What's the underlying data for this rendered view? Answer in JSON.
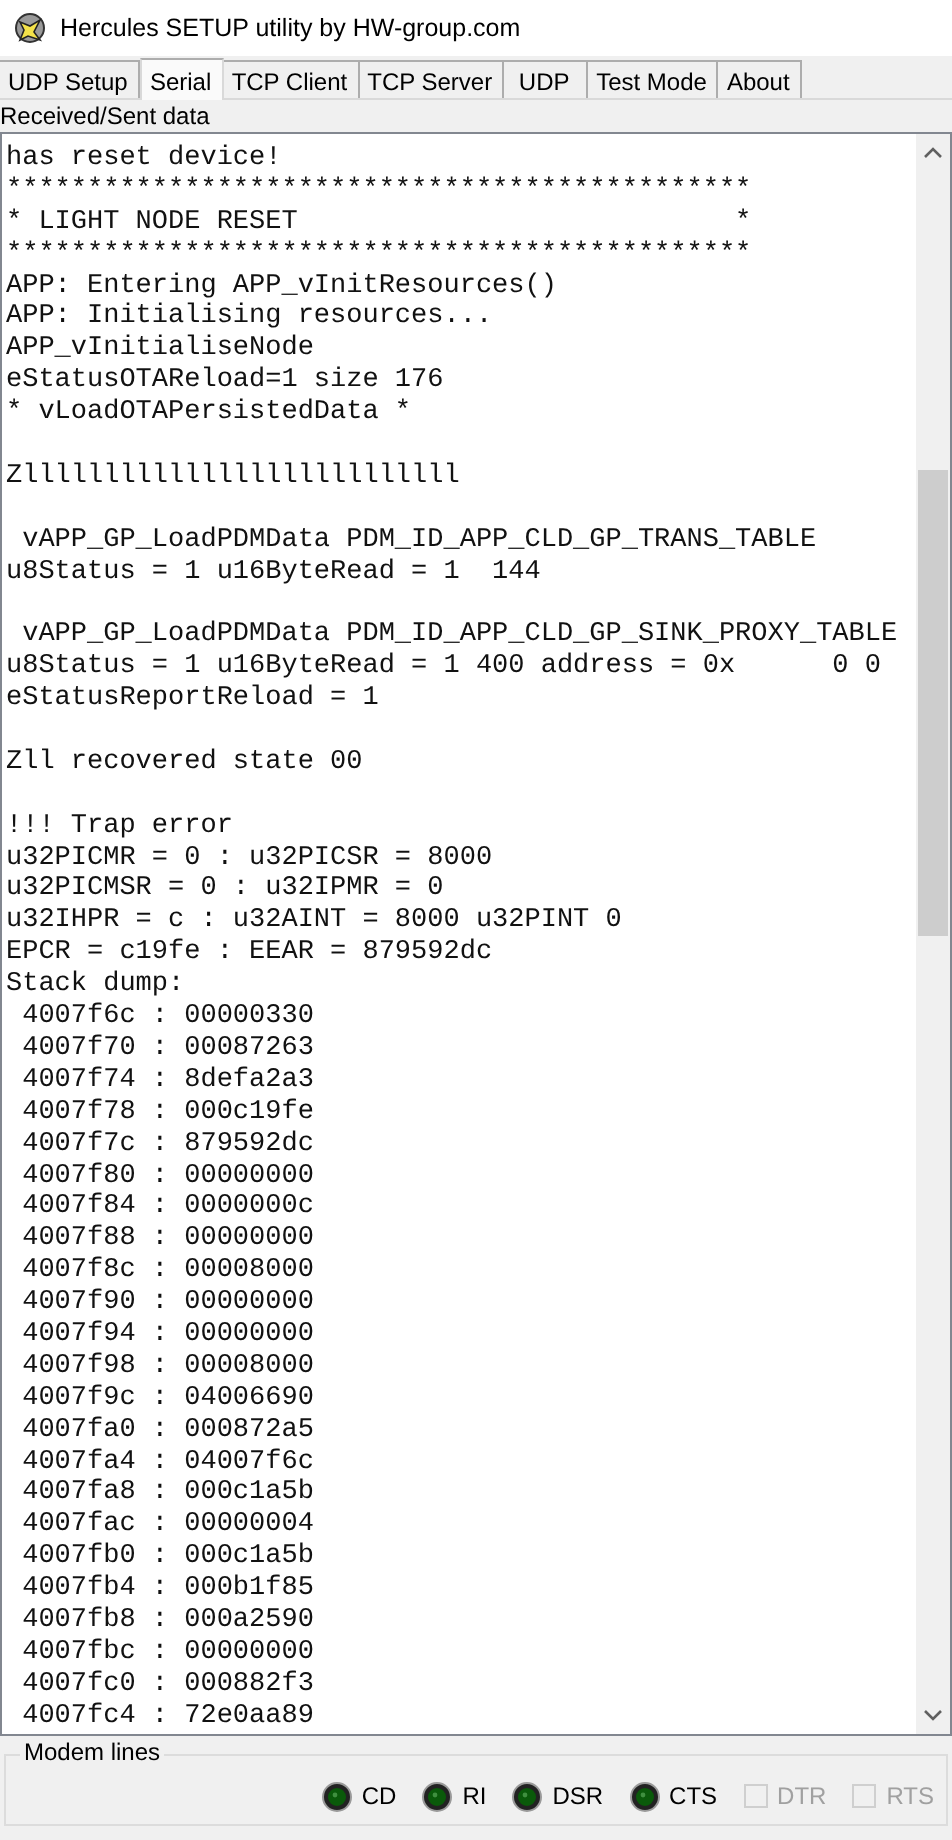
{
  "window": {
    "title": "Hercules SETUP utility by HW-group.com"
  },
  "tabs": [
    {
      "label": "UDP Setup",
      "selected": false
    },
    {
      "label": "Serial",
      "selected": true
    },
    {
      "label": "TCP Client",
      "selected": false
    },
    {
      "label": "TCP Server",
      "selected": false
    },
    {
      "label": "UDP",
      "selected": false
    },
    {
      "label": "Test Mode",
      "selected": false
    },
    {
      "label": "About",
      "selected": false
    }
  ],
  "data_label": "Received/Sent data",
  "log_blocks": [
    [
      "has reset device!",
      "**********************************************",
      "* LIGHT NODE RESET                           *",
      "**********************************************",
      "APP: Entering APP_vInitResources()",
      "APP: Initialising resources...",
      "APP_vInitialiseNode",
      "eStatusOTAReload=1 size 176",
      "* vLoadOTAPersistedData *"
    ],
    [
      "Zlllllllllllllllllllllllllll"
    ],
    [
      " vAPP_GP_LoadPDMData PDM_ID_APP_CLD_GP_TRANS_TABLE",
      "u8Status = 1 u16ByteRead = 1  144"
    ],
    [
      " vAPP_GP_LoadPDMData PDM_ID_APP_CLD_GP_SINK_PROXY_TABLE",
      "u8Status = 1 u16ByteRead = 1 400 address = 0x      0 0",
      "eStatusReportReload = 1"
    ],
    [
      "Zll recovered state 00"
    ],
    [
      "!!! Trap error",
      "u32PICMR = 0 : u32PICSR = 8000",
      "u32PICMSR = 0 : u32IPMR = 0",
      "u32IHPR = c : u32AINT = 8000 u32PINT 0",
      "EPCR = c19fe : EEAR = 879592dc",
      "Stack dump:",
      " 4007f6c : 00000330",
      " 4007f70 : 00087263",
      " 4007f74 : 8defa2a3",
      " 4007f78 : 000c19fe",
      " 4007f7c : 879592dc",
      " 4007f80 : 00000000",
      " 4007f84 : 0000000c",
      " 4007f88 : 00000000",
      " 4007f8c : 00008000",
      " 4007f90 : 00000000",
      " 4007f94 : 00000000",
      " 4007f98 : 00008000",
      " 4007f9c : 04006690",
      " 4007fa0 : 000872a5",
      " 4007fa4 : 04007f6c",
      " 4007fa8 : 000c1a5b",
      " 4007fac : 00000004",
      " 4007fb0 : 000c1a5b",
      " 4007fb4 : 000b1f85",
      " 4007fb8 : 000a2590",
      " 4007fbc : 00000000",
      " 4007fc0 : 000882f3",
      " 4007fc4 : 72e0aa89"
    ]
  ],
  "modem_lines": {
    "title": "Modem lines",
    "items": [
      {
        "kind": "led",
        "label": "CD",
        "on": false
      },
      {
        "kind": "led",
        "label": "RI",
        "on": false
      },
      {
        "kind": "led",
        "label": "DSR",
        "on": false
      },
      {
        "kind": "led",
        "label": "CTS",
        "on": false
      },
      {
        "kind": "checkbox",
        "label": "DTR",
        "checked": false,
        "disabled": true
      },
      {
        "kind": "checkbox",
        "label": "RTS",
        "checked": false,
        "disabled": true
      }
    ]
  }
}
